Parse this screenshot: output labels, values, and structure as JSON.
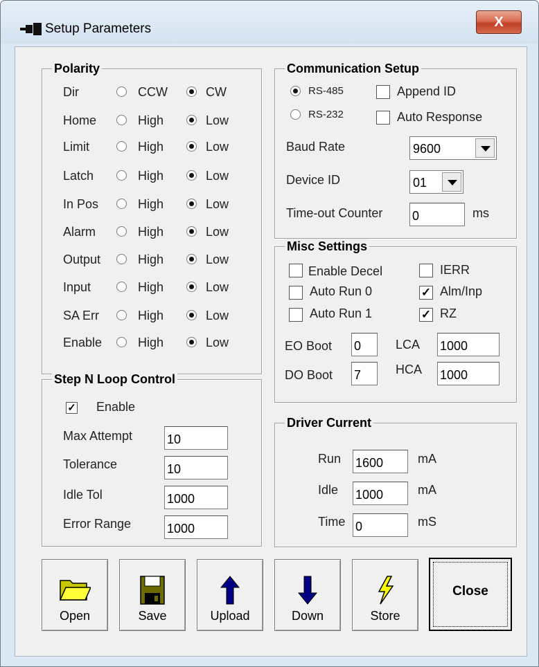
{
  "window": {
    "title": "Setup Parameters",
    "close_glyph": "X"
  },
  "polarity": {
    "title": "Polarity",
    "rows": [
      {
        "label": "Dir",
        "opt1": "CCW",
        "opt2": "CW"
      },
      {
        "label": "Home",
        "opt1": "High",
        "opt2": "Low"
      },
      {
        "label": "Limit",
        "opt1": "High",
        "opt2": "Low"
      },
      {
        "label": "Latch",
        "opt1": "High",
        "opt2": "Low"
      },
      {
        "label": "In Pos",
        "opt1": "High",
        "opt2": "Low"
      },
      {
        "label": "Alarm",
        "opt1": "High",
        "opt2": "Low"
      },
      {
        "label": "Output",
        "opt1": "High",
        "opt2": "Low"
      },
      {
        "label": "Input",
        "opt1": "High",
        "opt2": "Low"
      },
      {
        "label": "SA Err",
        "opt1": "High",
        "opt2": "Low"
      },
      {
        "label": "Enable",
        "opt1": "High",
        "opt2": "Low"
      }
    ]
  },
  "step_loop": {
    "title": "Step N Loop Control",
    "enable_label": "Enable",
    "enable_checked": true,
    "max_attempt_label": "Max Attempt",
    "max_attempt": "10",
    "tolerance_label": "Tolerance",
    "tolerance": "10",
    "idle_tol_label": "Idle Tol",
    "idle_tol": "1000",
    "error_range_label": "Error Range",
    "error_range": "1000"
  },
  "comm": {
    "title": "Communication Setup",
    "rs485": "RS-485",
    "rs232": "RS-232",
    "append_id": "Append ID",
    "auto_response": "Auto Response",
    "baud_label": "Baud Rate",
    "baud": "9600",
    "device_id_label": "Device ID",
    "device_id": "01",
    "timeout_label": "Time-out Counter",
    "timeout": "0",
    "timeout_unit": "ms"
  },
  "misc": {
    "title": "Misc Settings",
    "enable_decel": "Enable Decel",
    "ierr": "IERR",
    "auto_run0": "Auto Run 0",
    "alm_inp": "Alm/Inp",
    "auto_run1": "Auto Run 1",
    "rz": "RZ",
    "eo_boot_label": "EO Boot",
    "eo_boot": "0",
    "lca_label": "LCA",
    "lca": "1000",
    "do_boot_label": "DO Boot",
    "do_boot": "7",
    "hca_label": "HCA",
    "hca": "1000"
  },
  "driver": {
    "title": "Driver Current",
    "run_label": "Run",
    "run": "1600",
    "run_unit": "mA",
    "idle_label": "Idle",
    "idle": "1000",
    "idle_unit": "mA",
    "time_label": "Time",
    "time": "0",
    "time_unit": "mS"
  },
  "toolbar": {
    "open": "Open",
    "save": "Save",
    "upload": "Upload",
    "down": "Down",
    "store": "Store",
    "close": "Close"
  }
}
